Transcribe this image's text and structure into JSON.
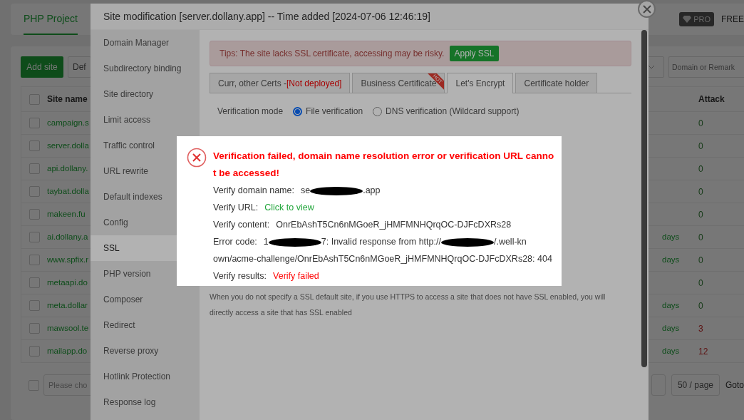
{
  "page": {
    "tab": "PHP Project",
    "pro_badge": "PRO",
    "free_label": "FREE",
    "toolbar": {
      "add_button": "Add site",
      "second_button": "Def",
      "search_placeholder": "Domain or Remark"
    },
    "table": {
      "columns": [
        "Site name",
        "Attack"
      ],
      "all_checked": false,
      "rows": [
        {
          "name": "campaign.s",
          "attack": "0",
          "high": false,
          "checked": false
        },
        {
          "name": "server.dolla",
          "attack": "0",
          "high": false,
          "checked": false
        },
        {
          "name": "api.dollany.",
          "attack": "0",
          "high": false,
          "checked": false
        },
        {
          "name": "taybat.dolla",
          "attack": "0",
          "high": false,
          "checked": false
        },
        {
          "name": "makeen.fu",
          "attack": "0",
          "high": false,
          "checked": false
        },
        {
          "name": "ai.dollany.a",
          "days": "days",
          "attack": "0",
          "high": false,
          "checked": false
        },
        {
          "name": "www.spfix.r",
          "days": "days",
          "attack": "0",
          "high": false,
          "checked": false
        },
        {
          "name": "metaapi.do",
          "attack": "0",
          "high": false,
          "checked": false
        },
        {
          "name": "meta.dollar",
          "days": "days",
          "attack": "0",
          "high": false,
          "checked": false
        },
        {
          "name": "mawsool.te",
          "days": "days",
          "attack": "3",
          "high": true,
          "checked": false
        },
        {
          "name": "mailapp.do",
          "days": "days",
          "attack": "12",
          "high": true,
          "checked": false
        }
      ]
    },
    "footer": {
      "checked": false,
      "select_placeholder": "Please cho",
      "page_size": "50 / page",
      "goto": "Goto"
    }
  },
  "modal": {
    "title": "Site modification [server.dollany.app] -- Time added [2024-07-06 12:46:19]",
    "menu": [
      {
        "label": "Domain Manager",
        "selected": false
      },
      {
        "label": "Subdirectory binding",
        "selected": false
      },
      {
        "label": "Site directory",
        "selected": false
      },
      {
        "label": "Limit access",
        "selected": false
      },
      {
        "label": "Traffic control",
        "selected": false
      },
      {
        "label": "URL rewrite",
        "selected": false
      },
      {
        "label": "Default indexes",
        "selected": false
      },
      {
        "label": "Config",
        "selected": false
      },
      {
        "label": "SSL",
        "selected": true
      },
      {
        "label": "PHP version",
        "selected": false
      },
      {
        "label": "Composer",
        "selected": false
      },
      {
        "label": "Redirect",
        "selected": false
      },
      {
        "label": "Reverse proxy",
        "selected": false
      },
      {
        "label": "Hotlink Protection",
        "selected": false
      },
      {
        "label": "Response log",
        "selected": false
      }
    ],
    "alert": {
      "text": "Tips: The site lacks SSL certificate, accessing may be risky.",
      "button": "Apply SSL"
    },
    "tabs": [
      {
        "label": "Curr, other Certs - ",
        "note": "[Not deployed]",
        "selected": false
      },
      {
        "label": "Business Certificate",
        "ribbon": "HOT",
        "selected": false
      },
      {
        "label": "Let's Encrypt",
        "selected": true
      },
      {
        "label": "Certificate holder",
        "selected": false
      }
    ],
    "verification": {
      "label": "Verification mode",
      "options": [
        {
          "label": "File verification",
          "selected": true
        },
        {
          "label": "DNS verification (Wildcard support)",
          "selected": false
        }
      ]
    },
    "note": [
      "When you do not specify a SSL default site, if you use HTTPS to access a site that does not have SSL enabled, you will",
      "directly access a site that has SSL enabled"
    ]
  },
  "dialog": {
    "title": "Verification failed, domain name resolution error or verification URL cannot be accessed!",
    "fields": [
      {
        "label": "Verify domain name:",
        "parts": [
          {
            "kind": "text",
            "text": "se"
          },
          {
            "kind": "redacted"
          },
          {
            "kind": "text",
            "text": ".app"
          }
        ]
      },
      {
        "label": "Verify URL:",
        "parts": [
          {
            "kind": "link",
            "text": "Click to view"
          }
        ]
      },
      {
        "label": "Verify content:",
        "parts": [
          {
            "kind": "text",
            "text": "OnrEbAshT5Cn6nMGoeR_jHMFMNHQrqOC-DJFcDXRs28"
          }
        ]
      },
      {
        "label": "Error code:",
        "parts": [
          {
            "kind": "text",
            "text": "1"
          },
          {
            "kind": "redacted"
          },
          {
            "kind": "text",
            "text": "7: Invalid response from http://"
          },
          {
            "kind": "redacted"
          },
          {
            "kind": "text",
            "text": "/.well-kn"
          },
          {
            "kind": "wrap",
            "text": "own/acme-challenge/OnrEbAshT5Cn6nMGoeR_jHMFMNHQrqOC-DJFcDXRs28: 404"
          }
        ]
      },
      {
        "label": "Verify results:",
        "parts": [
          {
            "kind": "error",
            "text": "Verify failed"
          }
        ]
      }
    ]
  }
}
